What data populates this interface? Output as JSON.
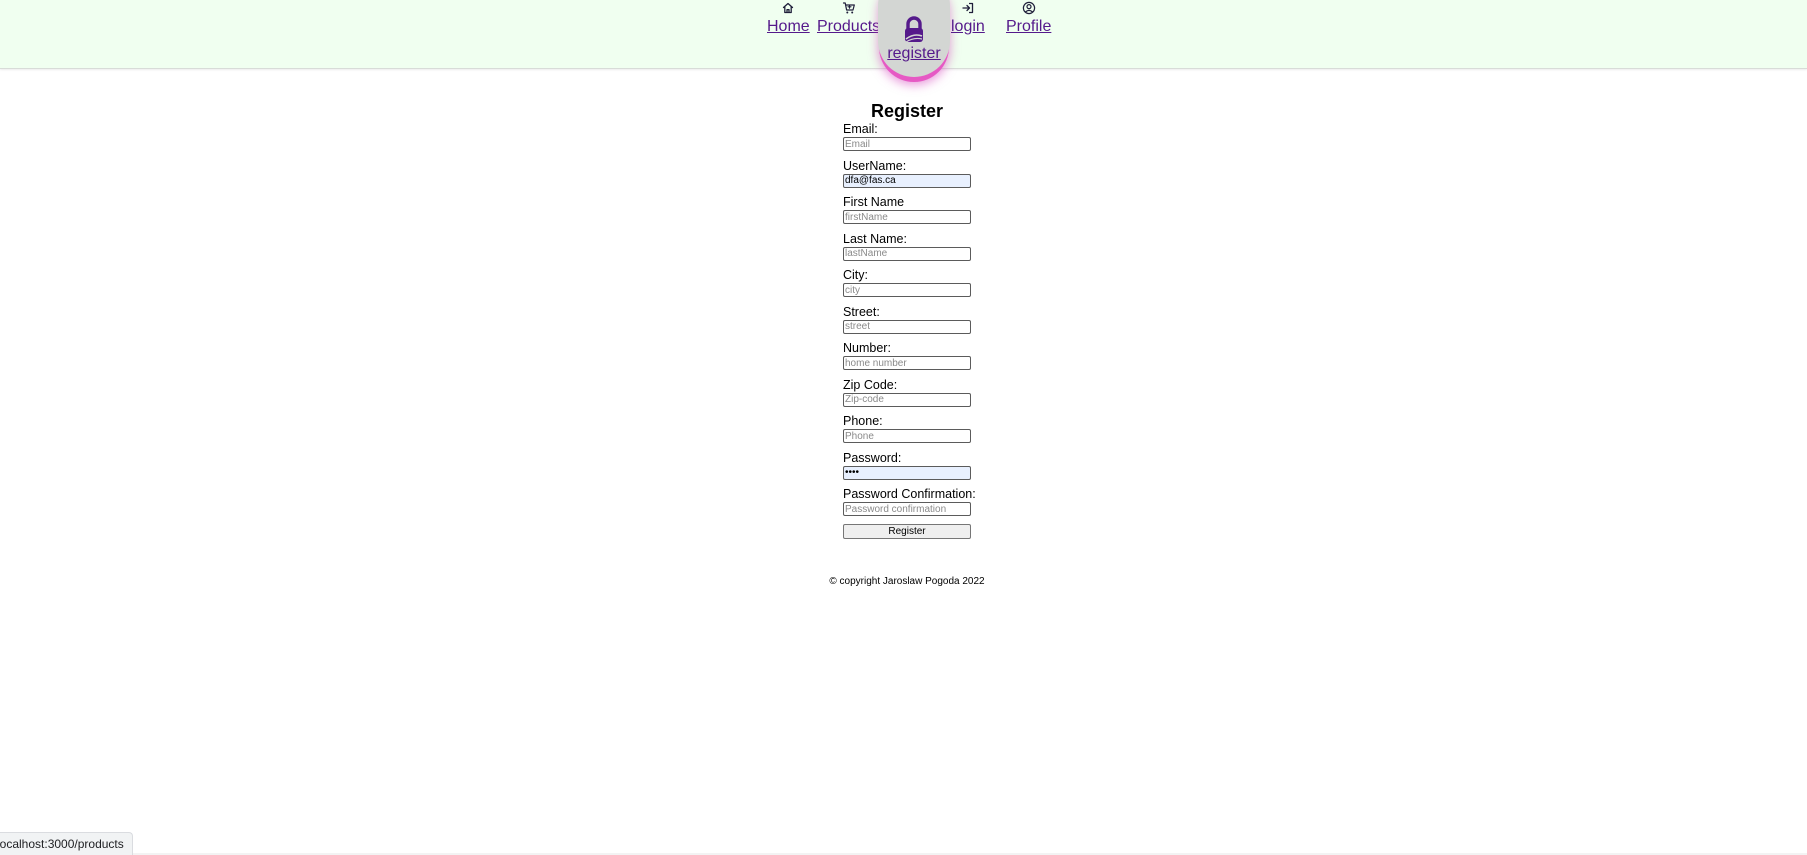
{
  "nav": {
    "home": {
      "label": "Home",
      "icon": "home-icon"
    },
    "products": {
      "label": "Products",
      "icon": "cart-icon"
    },
    "register": {
      "label": "register",
      "icon": "padlock-icon"
    },
    "login": {
      "label": "login",
      "icon": "login-icon"
    },
    "profile": {
      "label": "Profile",
      "icon": "user-circle-icon"
    },
    "link_color": "#551a8b",
    "bar_color": "#f0fff0",
    "active_glow_color": "#e659c4"
  },
  "form": {
    "title": "Register",
    "fields": [
      {
        "label": "Email:",
        "placeholder": "Email",
        "value": ""
      },
      {
        "label": "UserName:",
        "placeholder": "",
        "value": "dfa@fas.ca"
      },
      {
        "label": "First Name",
        "placeholder": "firstName",
        "value": ""
      },
      {
        "label": "Last Name:",
        "placeholder": "lastName",
        "value": ""
      },
      {
        "label": "City:",
        "placeholder": "city",
        "value": ""
      },
      {
        "label": "Street:",
        "placeholder": "street",
        "value": ""
      },
      {
        "label": "Number:",
        "placeholder": "home number",
        "value": ""
      },
      {
        "label": "Zip Code:",
        "placeholder": "Zip-code",
        "value": ""
      },
      {
        "label": "Phone:",
        "placeholder": "Phone",
        "value": ""
      },
      {
        "label": "Password:",
        "placeholder": "",
        "value": "••••"
      },
      {
        "label": "Password Confirmation:",
        "placeholder": "Password confirmation",
        "value": ""
      }
    ],
    "submit_label": "Register"
  },
  "footer": {
    "text": "© copyright Jaroslaw Pogoda 2022"
  },
  "status_bar": {
    "url": "localhost:3000/products"
  }
}
